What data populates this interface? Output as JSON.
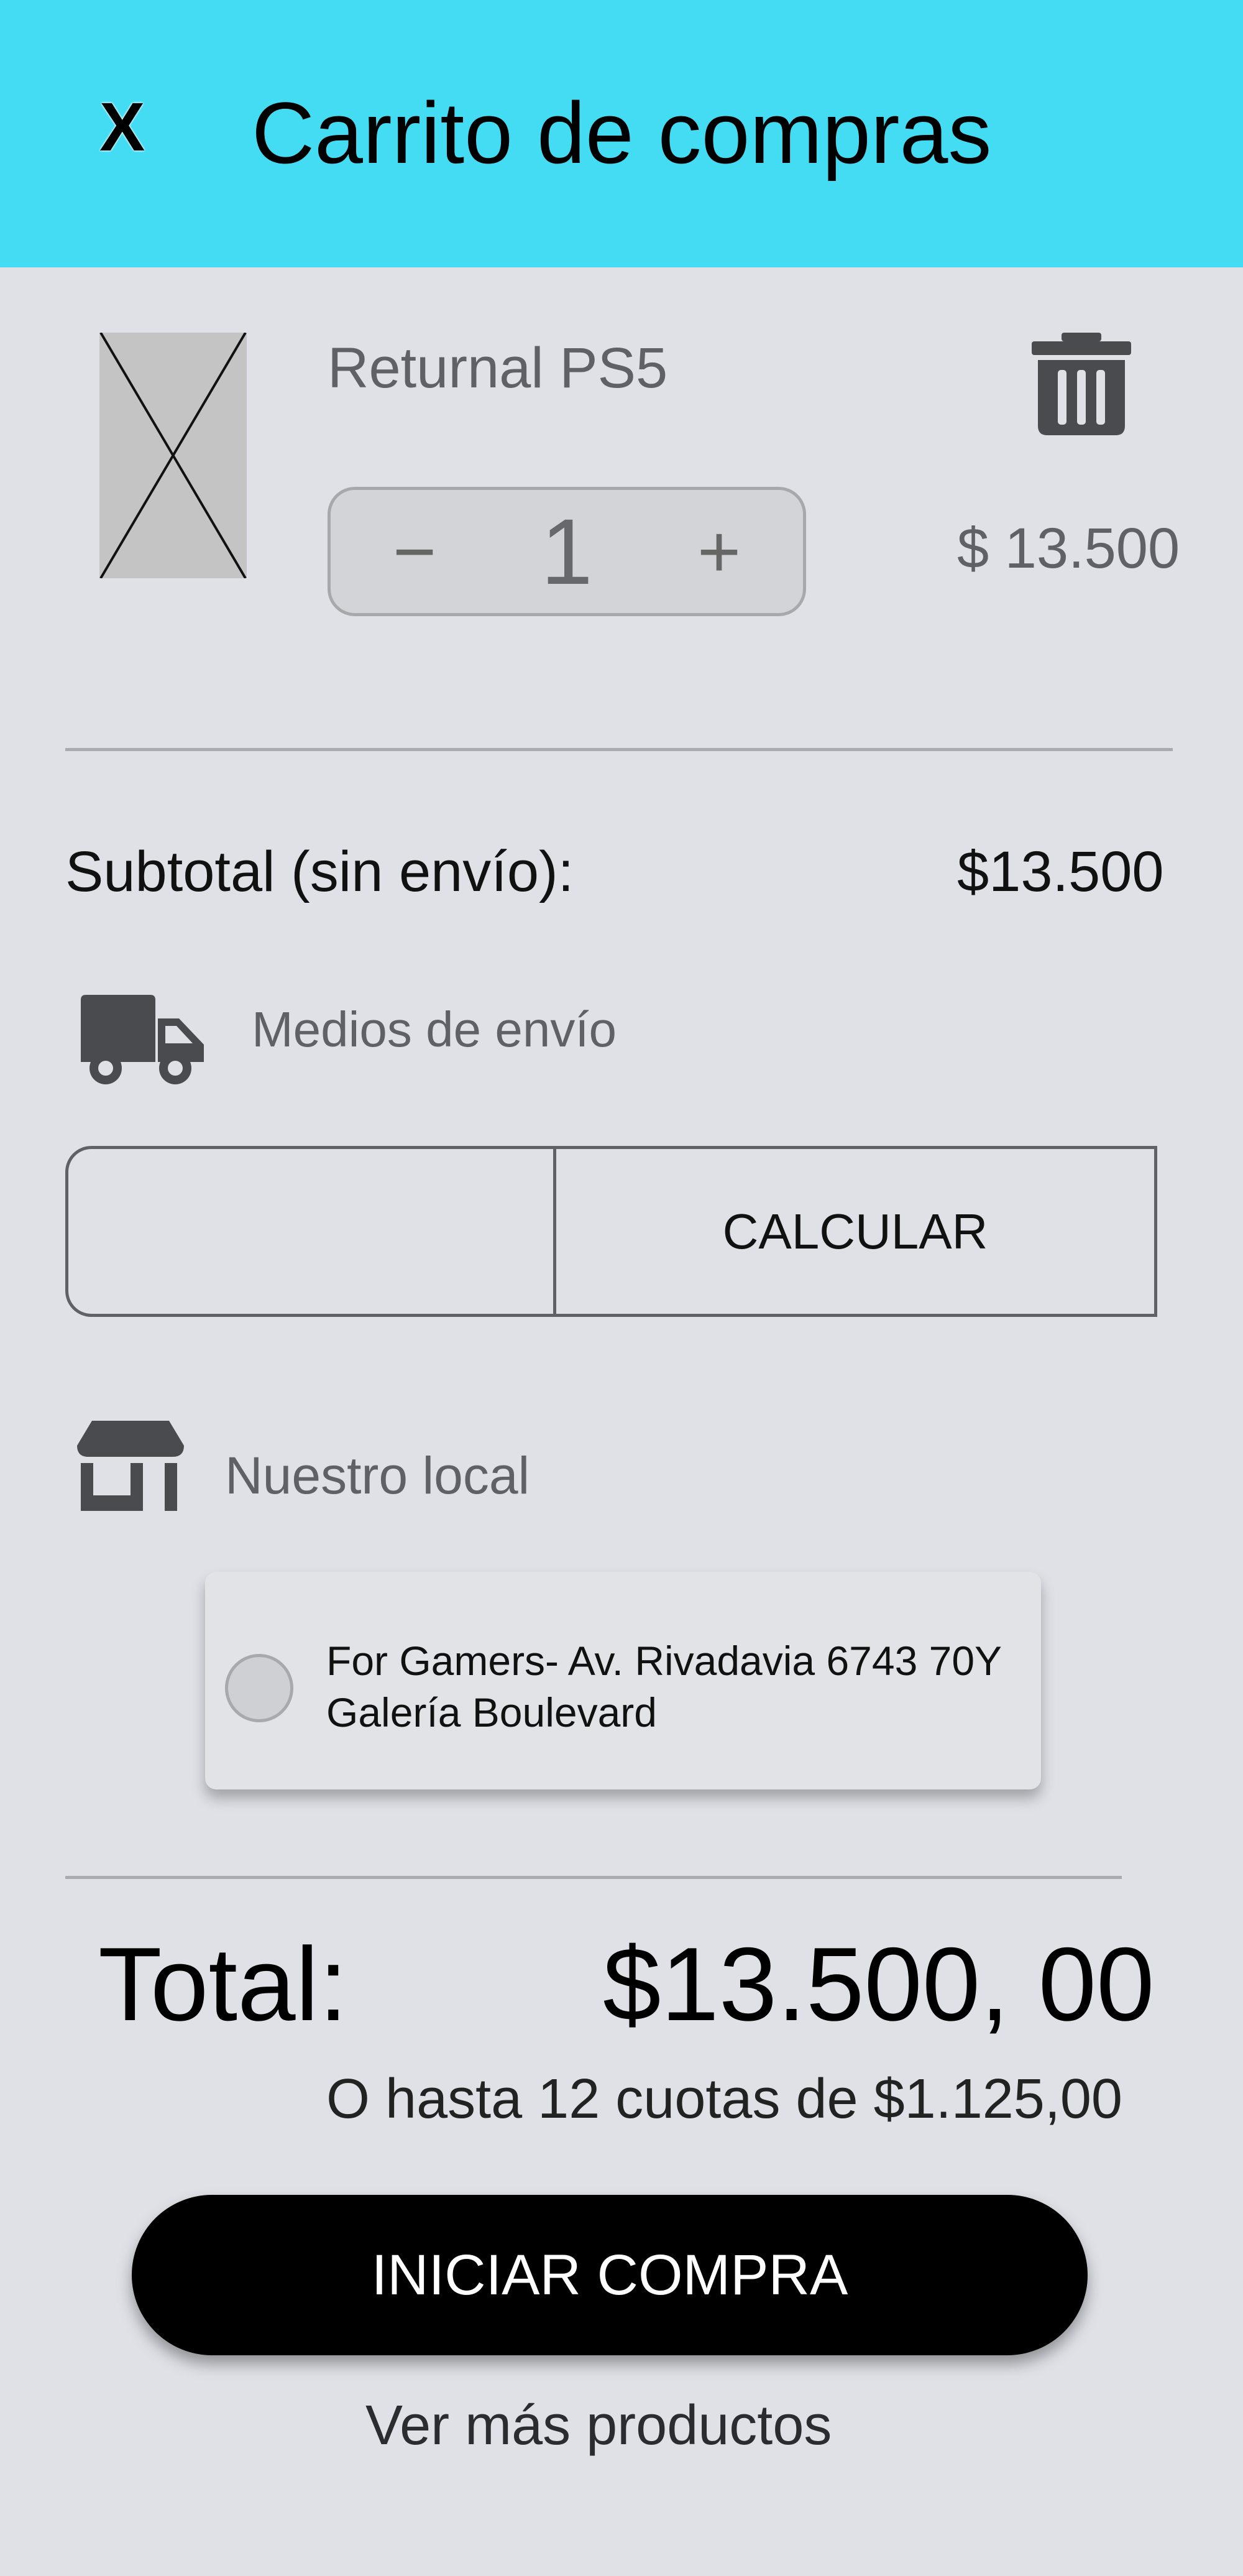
{
  "header": {
    "close_label": "X",
    "title": "Carrito de compras",
    "background": "#43dcf3"
  },
  "cart": {
    "items": [
      {
        "name": "Returnal PS5",
        "quantity": "1",
        "decrement_label": "−",
        "increment_label": "+",
        "price": "$ 13.500",
        "image_icon": "image-placeholder-icon",
        "delete_icon": "trash-icon"
      }
    ]
  },
  "subtotal": {
    "label": "Subtotal (sin envío):",
    "value": "$13.500"
  },
  "shipping": {
    "icon": "truck-icon",
    "label": "Medios de envío",
    "postal_code_value": "",
    "calculate_label": "CALCULAR"
  },
  "pickup": {
    "icon": "store-icon",
    "label": "Nuestro local",
    "options": [
      {
        "line1": "For Gamers- Av. Rivadavia 6743 70Y",
        "line2": "Galería Boulevard",
        "selected": false
      }
    ]
  },
  "totals": {
    "label": "Total:",
    "value": "$13.500, 00",
    "installments": "O hasta 12 cuotas de $1.125,00"
  },
  "actions": {
    "checkout_label": "INICIAR COMPRA",
    "more_products_label": "Ver más productos"
  }
}
